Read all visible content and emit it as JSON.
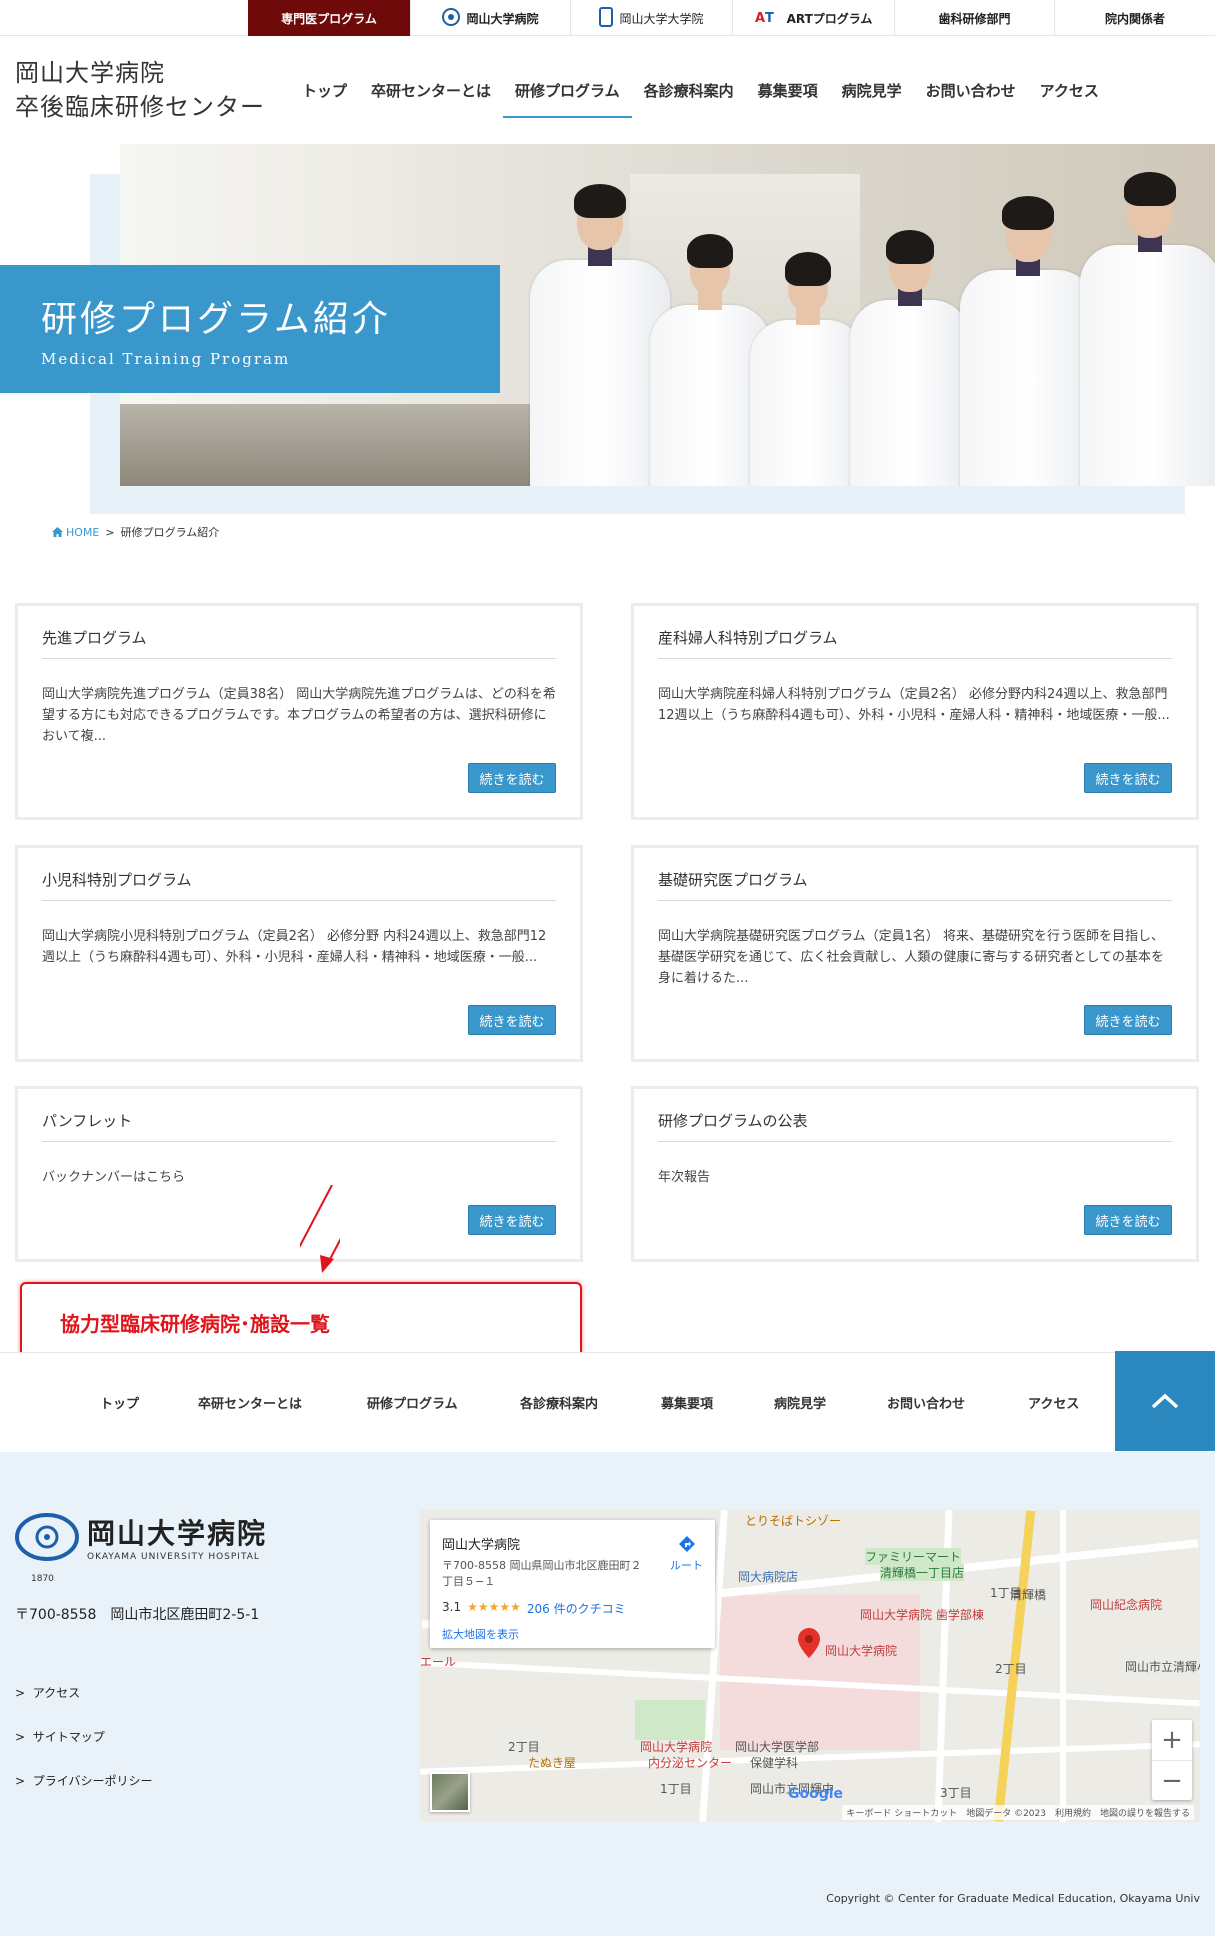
{
  "topbar": [
    {
      "label": "専門医プログラム"
    },
    {
      "label": "岡山大学病院"
    },
    {
      "label": "岡山大学大学院"
    },
    {
      "label": "ARTプログラム"
    },
    {
      "label": "歯科研修部門"
    },
    {
      "label": "院内関係者"
    }
  ],
  "site": {
    "title_line1": "岡山大学病院",
    "title_line2": "卒後臨床研修センター"
  },
  "gnav": [
    "トップ",
    "卒研センターとは",
    "研修プログラム",
    "各診療科案内",
    "募集要項",
    "病院見学",
    "お問い合わせ",
    "アクセス"
  ],
  "gnav_active": "研修プログラム",
  "hero": {
    "title": "研修プログラム紹介",
    "subtitle": "Medical Training Program"
  },
  "breadcrumb": {
    "home": "HOME",
    "current": "研修プログラム紹介"
  },
  "cards": [
    {
      "title": "先進プログラム",
      "body": "岡山大学病院先進プログラム（定員38名） 岡山大学病院先進プログラムは、どの科を希望する方にも対応できるプログラムです。本プログラムの希望者の方は、選択科研修において複...",
      "button": "続きを読む"
    },
    {
      "title": "産科婦人科特別プログラム",
      "body": "岡山大学病院産科婦人科特別プログラム（定員2名） 必修分野内科24週以上、救急部門12週以上（うち麻酔科4週も可）、外科・小児科・産婦人科・精神科・地域医療・一般...",
      "button": "続きを読む"
    },
    {
      "title": "小児科特別プログラム",
      "body": "岡山大学病院小児科特別プログラム（定員2名） 必修分野 内科24週以上、救急部門12週以上（うち麻酔科4週も可）、外科・小児科・産婦人科・精神科・地域医療・一般...",
      "button": "続きを読む"
    },
    {
      "title": "基礎研究医プログラム",
      "body": "岡山大学病院基礎研究医プログラム（定員1名） 将来、基礎研究を行う医師を目指し、基礎医学研究を通じて、広く社会貢献し、人類の健康に寄与する研究者としての基本を身に着けるた...",
      "button": "続きを読む"
    },
    {
      "title": "パンフレット",
      "body": "バックナンバーはこちら",
      "button": "続きを読む"
    },
    {
      "title": "研修プログラムの公表",
      "body": "年次報告",
      "button": "続きを読む"
    }
  ],
  "annotation": {
    "text": "協力型臨床研修病院･施設一覧",
    "color": "#e0151b"
  },
  "footer_nav": [
    "トップ",
    "卒研センターとは",
    "研修プログラム",
    "各診療科案内",
    "募集要項",
    "病院見学",
    "お問い合わせ",
    "アクセス"
  ],
  "footer": {
    "logo_jp": "岡山大学病院",
    "logo_en": "OKAYAMA UNIVERSITY HOSPITAL",
    "logo_year": "1870",
    "address": "〒700-8558　岡山市北区鹿田町2-5-1",
    "links": [
      "アクセス",
      "サイトマップ",
      "プライバシーポリシー"
    ],
    "copyright": "Copyright © Center for Graduate Medical Education, Okayama Univ"
  },
  "map": {
    "card_name": "岡山大学病院",
    "card_address": "〒700-8558 岡山県岡山市北区鹿田町２丁目５−１",
    "rating": "3.1",
    "stars": "★★★★★",
    "reviews": "206 件のクチコミ",
    "enlarge": "拡大地図を表示",
    "route": "ルート",
    "labels": {
      "l1": "とりそばトシゾー",
      "l2": "ファミリーマート",
      "l3": "清輝橋一丁目店",
      "l4": "岡大病院店",
      "l5": "清輝橋",
      "l6": "岡山紀念病院",
      "l7": "岡山大学病院 歯学部棟",
      "l8": "岡山大学病院",
      "l9": "2丁目",
      "l10": "岡山市立清輝小",
      "l11": "エール",
      "l12": "岡山大学病院",
      "l13": "内分泌センター",
      "l14": "岡山大学医学部",
      "l15": "保健学科",
      "l16": "たぬき屋",
      "l17": "1丁目",
      "l18": "2丁目",
      "l19": "岡山市立岡輝中",
      "l20": "3丁目",
      "l21": "1丁目"
    },
    "footer_text": "キーボード ショートカット　地図データ ©2023　利用規約　地図の誤りを報告する",
    "google": "Google"
  },
  "colors": {
    "accent": "#3a97cb",
    "topbar_first": "#6e0a0a",
    "footer_bg": "#e8f2f8"
  }
}
